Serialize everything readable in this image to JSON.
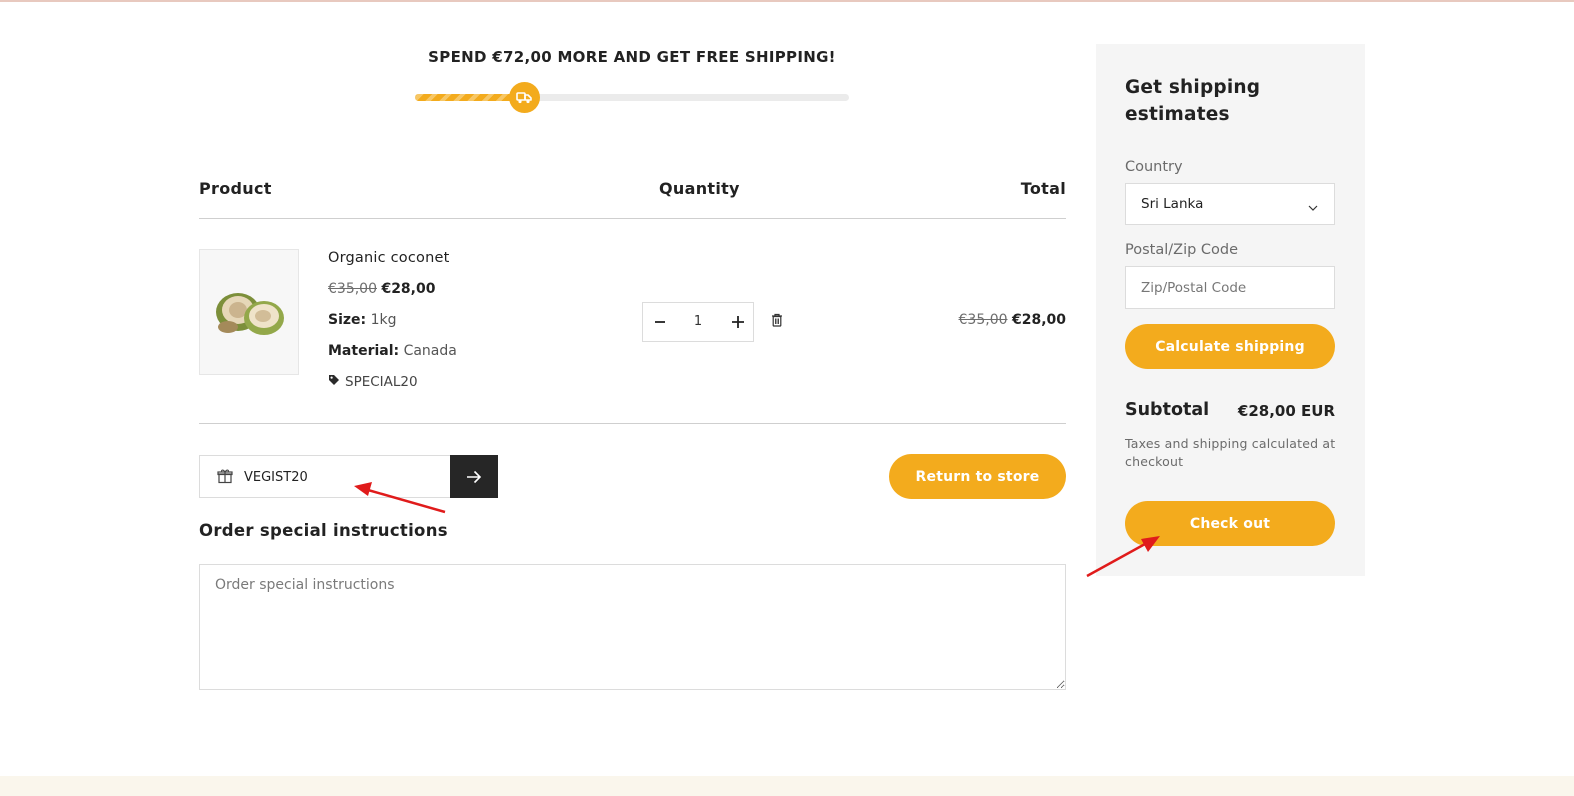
{
  "shipping_bar": {
    "message": "SPEND €72,00 MORE AND GET FREE SHIPPING!",
    "progress_fraction": 0.25,
    "icon": "truck-icon",
    "color": "#f3ab1d"
  },
  "cart_table": {
    "headers": {
      "product": "Product",
      "quantity": "Quantity",
      "total": "Total"
    }
  },
  "item": {
    "name": "Organic coconet",
    "compare_price": "€35,00",
    "price": "€28,00",
    "size_label": "Size:",
    "size_value": "1kg",
    "material_label": "Material:",
    "material_value": "Canada",
    "discount_code": "SPECIAL20",
    "quantity": "1",
    "line_compare_total": "€35,00",
    "line_total": "€28,00"
  },
  "coupon": {
    "value": "VEGIST20",
    "icon": "gift-icon"
  },
  "return_button": "Return to store",
  "instructions": {
    "title": "Order special instructions",
    "placeholder": "Order special instructions"
  },
  "sidebar": {
    "title": "Get shipping estimates",
    "country_label": "Country",
    "country_value": "Sri Lanka",
    "zip_label": "Postal/Zip Code",
    "zip_placeholder": "Zip/Postal Code",
    "calculate_button": "Calculate shipping",
    "subtotal_label": "Subtotal",
    "subtotal_value": "€28,00 EUR",
    "tax_note": "Taxes and shipping calculated at checkout",
    "checkout_button": "Check out"
  },
  "colors": {
    "accent": "#f3ab1d",
    "dark_button": "#262626",
    "annotation_arrow": "#e01b1b"
  }
}
